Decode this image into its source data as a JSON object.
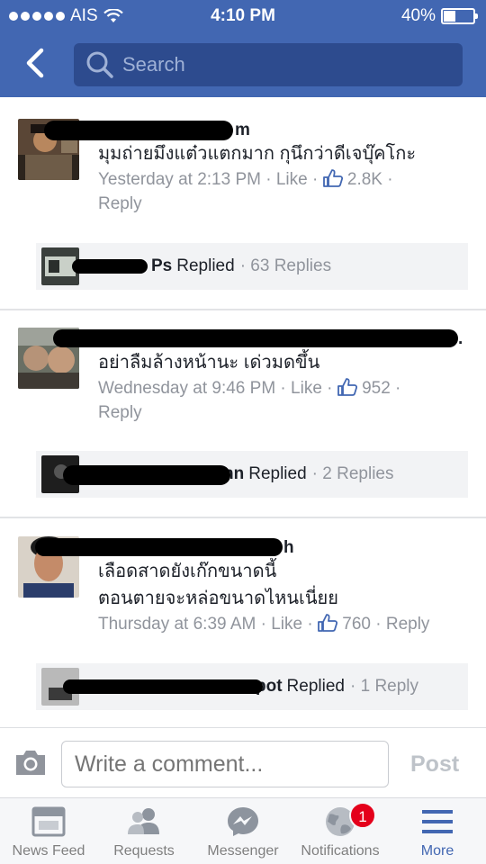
{
  "status_bar": {
    "carrier": "AIS",
    "time": "4:10 PM",
    "battery_percent": "40%",
    "battery_level": 0.4
  },
  "header": {
    "search_placeholder": "Search",
    "back_icon": "chevron-left-icon",
    "search_icon": "search-icon"
  },
  "comments": [
    {
      "author_visible": "m",
      "text_lines": [
        "มุมถ่ายมึงแต๋วแตกมาก กุนึกว่าดีเจบุ๊คโกะ"
      ],
      "time": "Yesterday at 2:13 PM",
      "like_label": "Like",
      "likes": "2.8K",
      "reply_label": "Reply",
      "replies_bar": {
        "name_visible": "Ps",
        "replied_label": "Replied",
        "count": "63 Replies"
      }
    },
    {
      "author_visible": ".",
      "text_lines": [
        "อย่าลืมล้างหน้านะ เด่วมดขึ้น"
      ],
      "time": "Wednesday at 9:46 PM",
      "like_label": "Like",
      "likes": "952",
      "reply_label": "Reply",
      "replies_bar": {
        "name_visible": "nn",
        "replied_label": "Replied",
        "count": "2 Replies"
      }
    },
    {
      "author_visible": "h",
      "text_lines": [
        "เลือดสาดยังเก๊กขนาดนี้",
        "ตอนตายจะหล่อขนาดไหนเนี่ยย"
      ],
      "time": "Thursday at 6:39 AM",
      "like_label": "Like",
      "likes": "760",
      "reply_label": "Reply",
      "replies_bar": {
        "name_visible": "pot",
        "replied_label": "Replied",
        "count": "1 Reply"
      }
    }
  ],
  "composer": {
    "placeholder": "Write a comment...",
    "post_label": "Post",
    "camera_icon": "camera-icon"
  },
  "tabs": [
    {
      "label": "News Feed",
      "icon": "news-feed-icon"
    },
    {
      "label": "Requests",
      "icon": "friend-requests-icon"
    },
    {
      "label": "Messenger",
      "icon": "messenger-icon"
    },
    {
      "label": "Notifications",
      "icon": "globe-icon",
      "badge": "1"
    },
    {
      "label": "More",
      "icon": "menu-icon",
      "active": true
    }
  ],
  "colors": {
    "brand": "#4267b2",
    "meta_gray": "#90949c",
    "badge_red": "#e4001b"
  }
}
